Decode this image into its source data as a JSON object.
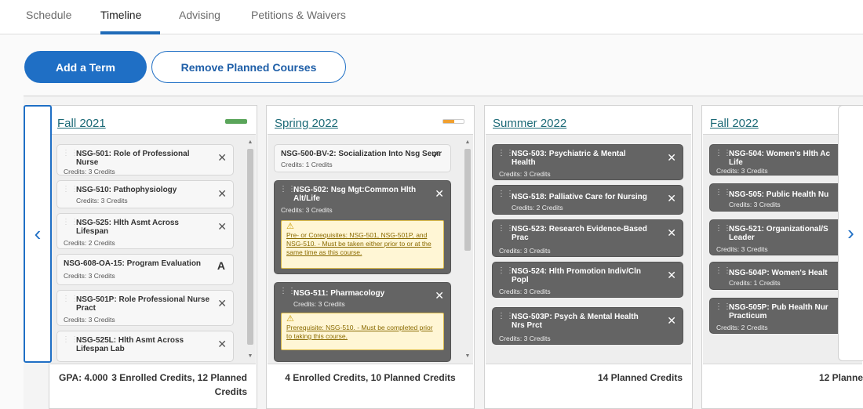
{
  "tabs": [
    {
      "label": "Schedule"
    },
    {
      "label": "Timeline"
    },
    {
      "label": "Advising"
    },
    {
      "label": "Petitions & Waivers"
    }
  ],
  "actions": {
    "add_term": "Add a Term",
    "remove_planned": "Remove Planned Courses"
  },
  "nav": {
    "prev": "‹",
    "next": "›"
  },
  "terms": [
    {
      "title": "Fall 2021",
      "bar_color": "#5aa55a",
      "footer_left": "GPA: 4.000",
      "footer_right": "3 Enrolled Credits, 12 Planned",
      "footer_right2": "Credits",
      "courses": [
        {
          "name": "NSG-501: Role of Professional",
          "name2": "Nurse",
          "credits": "Credits: 3 Credits"
        },
        {
          "name": "NSG-510: Pathophysiology",
          "credits": "Credits: 3 Credits"
        },
        {
          "name": "NSG-525: Hlth Asmt Across",
          "name2": "Lifespan",
          "credits": "Credits: 2 Credits"
        },
        {
          "name": "NSG-608-OA-15: Program Evaluation",
          "credits": "Credits: 3 Credits",
          "grade": "A"
        },
        {
          "name": "NSG-501P: Role Professional Nurse",
          "name2": "Pract",
          "credits": "Credits: 3 Credits"
        },
        {
          "name": "NSG-525L: Hlth Asmt Across",
          "name2": "Lifespan Lab"
        }
      ]
    },
    {
      "title": "Spring 2022",
      "bar_color": "#f0a030",
      "footer": "4 Enrolled Credits, 10 Planned Credits",
      "courses": [
        {
          "name": "NSG-500-BV-2: Socialization Into Nsg Semr",
          "credits": "Credits: 1 Credits"
        },
        {
          "name": "NSG-502: Nsg Mgt:Common Hlth",
          "name2": "Alt/Life",
          "credits": "Credits: 3 Credits",
          "warning": "Pre- or Corequisites: NSG-501, NSG-501P, and NSG-510. - Must be taken either prior to or at the same time as this course."
        },
        {
          "name": "NSG-511: Pharmacology",
          "credits": "Credits: 3 Credits",
          "warning": "Prerequisite: NSG-510. - Must be completed prior to taking this course."
        }
      ]
    },
    {
      "title": "Summer 2022",
      "footer": "14 Planned Credits",
      "courses": [
        {
          "name": "NSG-503: Psychiatric & Mental",
          "name2": "Health",
          "credits": "Credits: 3 Credits"
        },
        {
          "name": "NSG-518: Palliative Care for Nursing",
          "credits": "Credits: 2 Credits"
        },
        {
          "name": "NSG-523: Research Evidence-Based",
          "name2": "Prac",
          "credits": "Credits: 3 Credits"
        },
        {
          "name": "NSG-524: Hlth Promotion Indiv/Cln",
          "name2": "Popl",
          "credits": "Credits: 3 Credits"
        },
        {
          "name": "NSG-503P: Psych & Mental Health",
          "name2": "Nrs Prct",
          "credits": "Credits: 3 Credits"
        }
      ]
    },
    {
      "title": "Fall 2022",
      "footer": "12 Planne",
      "courses": [
        {
          "name": "NSG-504: Women's Hlth Ac",
          "name2": "Life",
          "credits": "Credits: 3 Credits"
        },
        {
          "name": "NSG-505: Public Health Nu",
          "credits": "Credits: 3 Credits"
        },
        {
          "name": "NSG-521: Organizational/S",
          "name2": "Leader",
          "credits": "Credits: 3 Credits"
        },
        {
          "name": "NSG-504P: Women's Healt",
          "credits": "Credits: 1 Credits"
        },
        {
          "name": "NSG-505P: Pub Health Nur",
          "name2": "Practicum",
          "credits": "Credits: 2 Credits"
        }
      ]
    }
  ]
}
